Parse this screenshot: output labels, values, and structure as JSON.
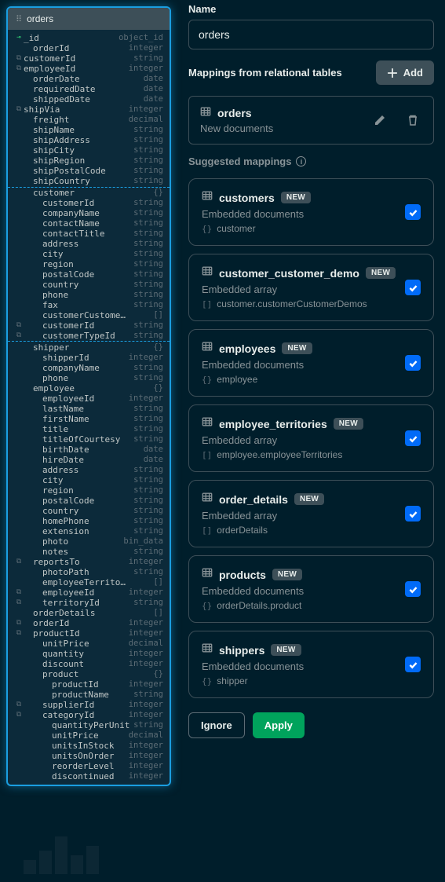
{
  "schema": {
    "title": "orders",
    "fields": [
      {
        "icon": "key",
        "name": "_id",
        "type": "object_id",
        "indent": 0
      },
      {
        "icon": "",
        "name": "orderId",
        "type": "integer",
        "indent": 0
      },
      {
        "icon": "link",
        "name": "customerId",
        "type": "string",
        "indent": 0
      },
      {
        "icon": "link",
        "name": "employeeId",
        "type": "integer",
        "indent": 0
      },
      {
        "icon": "",
        "name": "orderDate",
        "type": "date",
        "indent": 0
      },
      {
        "icon": "",
        "name": "requiredDate",
        "type": "date",
        "indent": 0
      },
      {
        "icon": "",
        "name": "shippedDate",
        "type": "date",
        "indent": 0
      },
      {
        "icon": "link",
        "name": "shipVia",
        "type": "integer",
        "indent": 0
      },
      {
        "icon": "",
        "name": "freight",
        "type": "decimal",
        "indent": 0
      },
      {
        "icon": "",
        "name": "shipName",
        "type": "string",
        "indent": 0
      },
      {
        "icon": "",
        "name": "shipAddress",
        "type": "string",
        "indent": 0
      },
      {
        "icon": "",
        "name": "shipCity",
        "type": "string",
        "indent": 0
      },
      {
        "icon": "",
        "name": "shipRegion",
        "type": "string",
        "indent": 0
      },
      {
        "icon": "",
        "name": "shipPostalCode",
        "type": "string",
        "indent": 0
      },
      {
        "icon": "",
        "name": "shipCountry",
        "type": "string",
        "indent": 0
      }
    ],
    "highlighted_group": {
      "parent": {
        "name": "customer",
        "type": "{}",
        "indent": 0
      },
      "children": [
        {
          "icon": "",
          "name": "customerId",
          "type": "string",
          "indent": 1
        },
        {
          "icon": "",
          "name": "companyName",
          "type": "string",
          "indent": 1
        },
        {
          "icon": "",
          "name": "contactName",
          "type": "string",
          "indent": 1
        },
        {
          "icon": "",
          "name": "contactTitle",
          "type": "string",
          "indent": 1
        },
        {
          "icon": "",
          "name": "address",
          "type": "string",
          "indent": 1
        },
        {
          "icon": "",
          "name": "city",
          "type": "string",
          "indent": 1
        },
        {
          "icon": "",
          "name": "region",
          "type": "string",
          "indent": 1
        },
        {
          "icon": "",
          "name": "postalCode",
          "type": "string",
          "indent": 1
        },
        {
          "icon": "",
          "name": "country",
          "type": "string",
          "indent": 1
        },
        {
          "icon": "",
          "name": "phone",
          "type": "string",
          "indent": 1
        },
        {
          "icon": "",
          "name": "fax",
          "type": "string",
          "indent": 1
        },
        {
          "icon": "",
          "name": "customerCustome…",
          "type": "[]",
          "indent": 1
        },
        {
          "icon": "link",
          "name": "customerId",
          "type": "string",
          "indent": 2,
          "outer": true
        },
        {
          "icon": "link",
          "name": "customerTypeId",
          "type": "string",
          "indent": 2,
          "outer": true
        }
      ]
    },
    "rest": [
      {
        "icon": "",
        "name": "shipper",
        "type": "{}",
        "indent": 0
      },
      {
        "icon": "",
        "name": "shipperId",
        "type": "integer",
        "indent": 1
      },
      {
        "icon": "",
        "name": "companyName",
        "type": "string",
        "indent": 1
      },
      {
        "icon": "",
        "name": "phone",
        "type": "string",
        "indent": 1
      },
      {
        "icon": "",
        "name": "employee",
        "type": "{}",
        "indent": 0
      },
      {
        "icon": "",
        "name": "employeeId",
        "type": "integer",
        "indent": 1
      },
      {
        "icon": "",
        "name": "lastName",
        "type": "string",
        "indent": 1
      },
      {
        "icon": "",
        "name": "firstName",
        "type": "string",
        "indent": 1
      },
      {
        "icon": "",
        "name": "title",
        "type": "string",
        "indent": 1
      },
      {
        "icon": "",
        "name": "titleOfCourtesy",
        "type": "string",
        "indent": 1
      },
      {
        "icon": "",
        "name": "birthDate",
        "type": "date",
        "indent": 1
      },
      {
        "icon": "",
        "name": "hireDate",
        "type": "date",
        "indent": 1
      },
      {
        "icon": "",
        "name": "address",
        "type": "string",
        "indent": 1
      },
      {
        "icon": "",
        "name": "city",
        "type": "string",
        "indent": 1
      },
      {
        "icon": "",
        "name": "region",
        "type": "string",
        "indent": 1
      },
      {
        "icon": "",
        "name": "postalCode",
        "type": "string",
        "indent": 1
      },
      {
        "icon": "",
        "name": "country",
        "type": "string",
        "indent": 1
      },
      {
        "icon": "",
        "name": "homePhone",
        "type": "string",
        "indent": 1
      },
      {
        "icon": "",
        "name": "extension",
        "type": "string",
        "indent": 1
      },
      {
        "icon": "",
        "name": "photo",
        "type": "bin_data",
        "indent": 1
      },
      {
        "icon": "",
        "name": "notes",
        "type": "string",
        "indent": 1
      },
      {
        "icon": "link",
        "name": "reportsTo",
        "type": "integer",
        "indent": 1,
        "outer": true
      },
      {
        "icon": "",
        "name": "photoPath",
        "type": "string",
        "indent": 1
      },
      {
        "icon": "",
        "name": "employeeTerrito…",
        "type": "[]",
        "indent": 1
      },
      {
        "icon": "link",
        "name": "employeeId",
        "type": "integer",
        "indent": 2,
        "outer": true
      },
      {
        "icon": "link",
        "name": "territoryId",
        "type": "string",
        "indent": 2,
        "outer": true
      },
      {
        "icon": "",
        "name": "orderDetails",
        "type": "[]",
        "indent": 0
      },
      {
        "icon": "link",
        "name": "orderId",
        "type": "integer",
        "indent": 1,
        "outer": true
      },
      {
        "icon": "link",
        "name": "productId",
        "type": "integer",
        "indent": 1,
        "outer": true
      },
      {
        "icon": "",
        "name": "unitPrice",
        "type": "decimal",
        "indent": 1
      },
      {
        "icon": "",
        "name": "quantity",
        "type": "integer",
        "indent": 1
      },
      {
        "icon": "",
        "name": "discount",
        "type": "integer",
        "indent": 1
      },
      {
        "icon": "",
        "name": "product",
        "type": "{}",
        "indent": 1
      },
      {
        "icon": "",
        "name": "productId",
        "type": "integer",
        "indent": 2
      },
      {
        "icon": "",
        "name": "productName",
        "type": "string",
        "indent": 2
      },
      {
        "icon": "link",
        "name": "supplierId",
        "type": "integer",
        "indent": 2,
        "outer": true
      },
      {
        "icon": "link",
        "name": "categoryId",
        "type": "integer",
        "indent": 2,
        "outer": true
      },
      {
        "icon": "",
        "name": "quantityPerUnit",
        "type": "string",
        "indent": 2
      },
      {
        "icon": "",
        "name": "unitPrice",
        "type": "decimal",
        "indent": 2
      },
      {
        "icon": "",
        "name": "unitsInStock",
        "type": "integer",
        "indent": 2
      },
      {
        "icon": "",
        "name": "unitsOnOrder",
        "type": "integer",
        "indent": 2
      },
      {
        "icon": "",
        "name": "reorderLevel",
        "type": "integer",
        "indent": 2
      },
      {
        "icon": "",
        "name": "discontinued",
        "type": "integer",
        "indent": 2
      }
    ]
  },
  "form": {
    "name_label": "Name",
    "name_value": "orders",
    "mappings_label": "Mappings from relational tables",
    "add_label": "Add"
  },
  "root_mapping": {
    "name": "orders",
    "sub": "New documents"
  },
  "suggested_label": "Suggested mappings",
  "suggestions": [
    {
      "name": "customers",
      "badge": "NEW",
      "kind": "Embedded documents",
      "path_icon": "{}",
      "path": "customer"
    },
    {
      "name": "customer_customer_demo",
      "badge": "NEW",
      "kind": "Embedded array",
      "path_icon": "[]",
      "path": "customer.customerCustomerDemos"
    },
    {
      "name": "employees",
      "badge": "NEW",
      "kind": "Embedded documents",
      "path_icon": "{}",
      "path": "employee"
    },
    {
      "name": "employee_territories",
      "badge": "NEW",
      "kind": "Embedded array",
      "path_icon": "[]",
      "path": "employee.employeeTerritories"
    },
    {
      "name": "order_details",
      "badge": "NEW",
      "kind": "Embedded array",
      "path_icon": "[]",
      "path": "orderDetails"
    },
    {
      "name": "products",
      "badge": "NEW",
      "kind": "Embedded documents",
      "path_icon": "{}",
      "path": "orderDetails.product"
    },
    {
      "name": "shippers",
      "badge": "NEW",
      "kind": "Embedded documents",
      "path_icon": "{}",
      "path": "shipper"
    }
  ],
  "footer": {
    "ignore": "Ignore",
    "apply": "Apply"
  }
}
